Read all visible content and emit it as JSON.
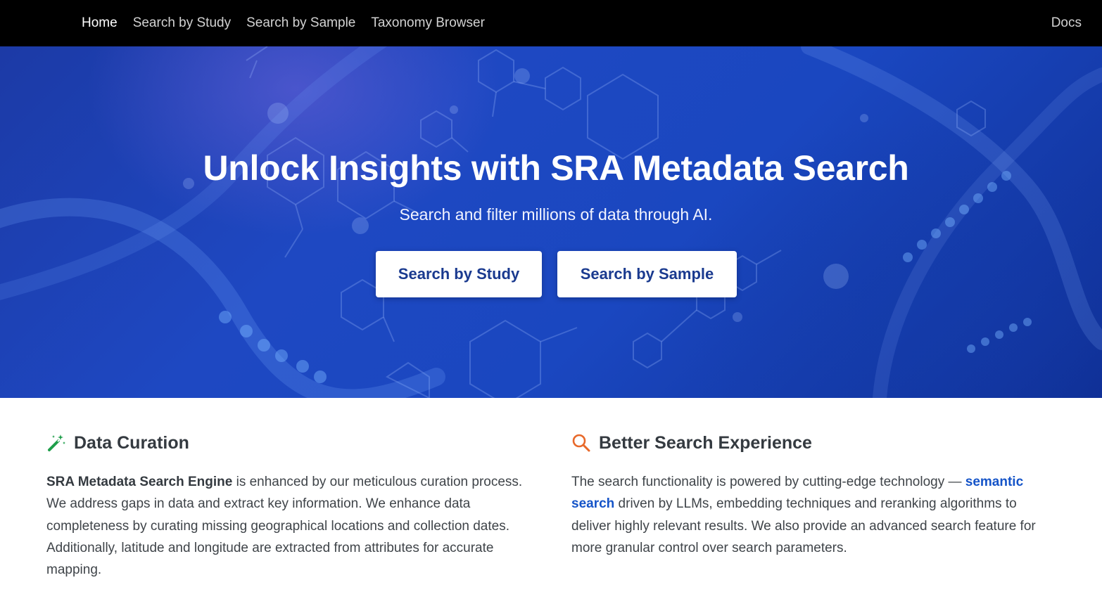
{
  "navbar": {
    "items": [
      {
        "label": "Home",
        "active": true
      },
      {
        "label": "Search by Study",
        "active": false
      },
      {
        "label": "Search by Sample",
        "active": false
      },
      {
        "label": "Taxonomy Browser",
        "active": false
      }
    ],
    "docs_label": "Docs"
  },
  "hero": {
    "title": "Unlock Insights with SRA Metadata Search",
    "subtitle": "Search and filter millions of data through AI.",
    "buttons": {
      "study": "Search by Study",
      "sample": "Search by Sample"
    }
  },
  "features": {
    "curation": {
      "icon": "magic-wand-icon",
      "title": "Data Curation",
      "text_bold": "SRA Metadata Search Engine",
      "text_rest": " is enhanced by our meticulous curation process. We address gaps in data and extract key information. We enhance data completeness by curating missing geographical locations and collection dates. Additionally, latitude and longitude are extracted from attributes for accurate mapping."
    },
    "search": {
      "icon": "search-icon",
      "title": "Better Search Experience",
      "text_before": "The search functionality is powered by cutting-edge technology — ",
      "link_text": "semantic search",
      "text_after": " driven by LLMs, embedding techniques and reranking algorithms to deliver highly relevant results. We also provide an advanced search feature for more granular control over search parameters."
    }
  },
  "colors": {
    "navbar_bg": "#000000",
    "hero_blue": "#1e48c2",
    "button_text": "#1a3a8f",
    "link": "#1554c8",
    "wand_green": "#1e9e4a",
    "search_orange": "#e8692a"
  }
}
